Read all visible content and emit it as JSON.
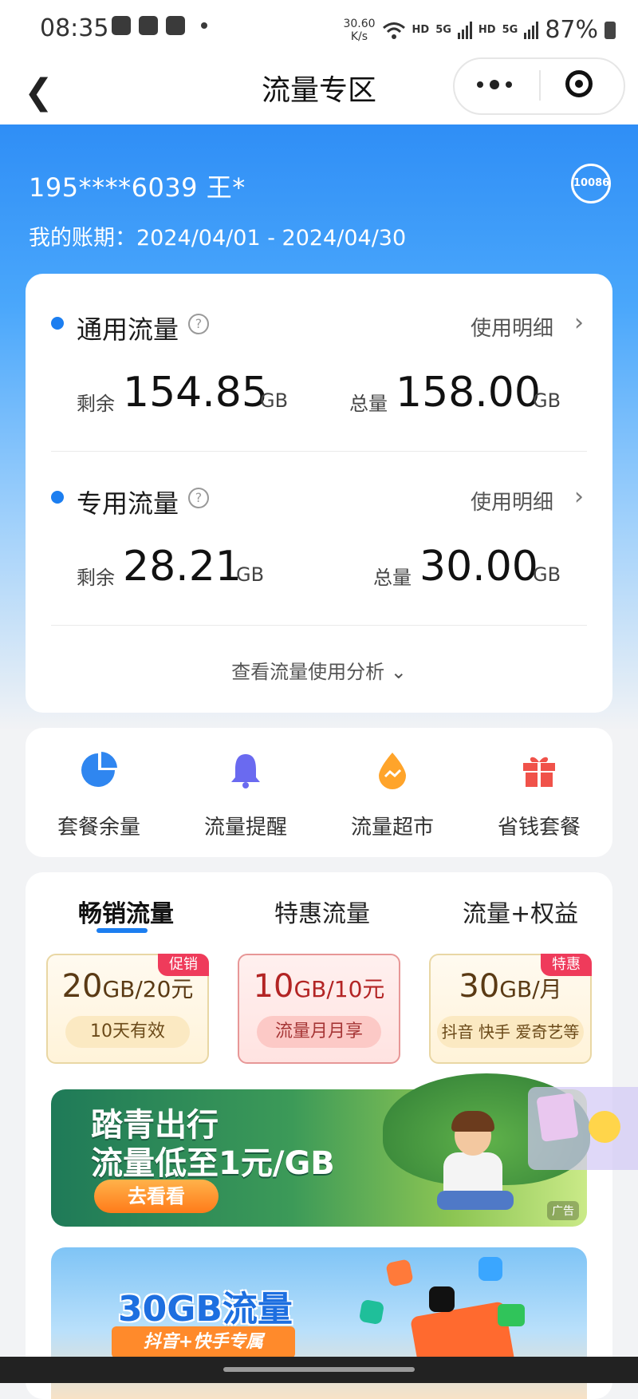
{
  "status_bar": {
    "time": "08:35",
    "net_speed": "30.60",
    "net_speed_unit": "K/s",
    "hd1": "HD",
    "signal1": "5G",
    "hd2": "HD",
    "signal2": "5G",
    "battery": "87%"
  },
  "nav": {
    "title": "流量专区"
  },
  "account": {
    "phone": "195****6039 王*",
    "period": "我的账期：2024/04/01 - 2024/04/30",
    "hotline": "10086"
  },
  "general": {
    "title": "通用流量",
    "detail": "使用明细",
    "remain_label": "剩余",
    "remain_value": "154.85",
    "remain_unit": "GB",
    "total_label": "总量",
    "total_value": "158.00",
    "total_unit": "GB"
  },
  "special": {
    "title": "专用流量",
    "detail": "使用明细",
    "remain_label": "剩余",
    "remain_value": "28.21",
    "remain_unit": "GB",
    "total_label": "总量",
    "total_value": "30.00",
    "total_unit": "GB"
  },
  "analyze": "查看流量使用分析",
  "shortcuts": [
    {
      "label": "套餐余量",
      "icon": "pie-chart-icon",
      "color": "#2f86f0"
    },
    {
      "label": "流量提醒",
      "icon": "bell-icon",
      "color": "#6a6af0"
    },
    {
      "label": "流量超市",
      "icon": "drop-icon",
      "color": "#ffa42a"
    },
    {
      "label": "省钱套餐",
      "icon": "gift-icon",
      "color": "#f0524a"
    }
  ],
  "tabs": [
    "畅销流量",
    "特惠流量",
    "流量+权益"
  ],
  "products": [
    {
      "num": "20",
      "unit": "GB/20元",
      "sub": "10天有效",
      "tag": "促销"
    },
    {
      "num": "10",
      "unit": "GB/10元",
      "sub": "流量月月享",
      "tag": ""
    },
    {
      "num": "30",
      "unit": "GB/月",
      "sub": "抖音 快手 爱奇艺等",
      "tag": "特惠"
    }
  ],
  "banner1": {
    "line1": "踏青出行",
    "line2": "流量低至1元/GB",
    "button": "去看看",
    "ad": "广告"
  },
  "banner2": {
    "title": "30GB流量",
    "sub": "抖音+快手专属"
  }
}
